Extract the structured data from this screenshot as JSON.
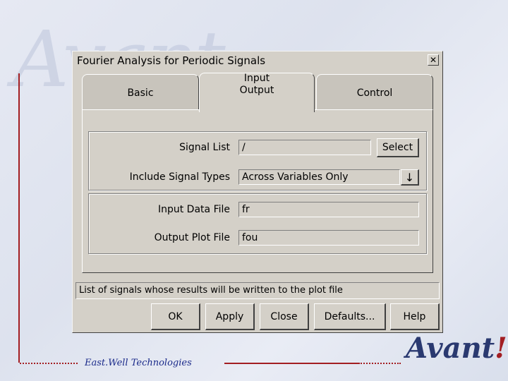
{
  "background": {
    "logo_text": "Avant",
    "footer_text": "East.Well Technologies",
    "corner_logo": "Avant",
    "corner_logo_mark": "!",
    "accent_color": "#a31e22",
    "logo_color": "#2a3970"
  },
  "window": {
    "title": "Fourier Analysis for Periodic Signals",
    "close_glyph": "✕"
  },
  "tabs": [
    {
      "label": "Basic",
      "active": false
    },
    {
      "label": "Input\nOutput",
      "active": true
    },
    {
      "label": "Control",
      "active": false
    }
  ],
  "form": {
    "signal_list": {
      "label": "Signal List",
      "value": "/",
      "button": "Select"
    },
    "signal_types": {
      "label": "Include Signal Types",
      "value": "Across Variables Only",
      "dropdown_glyph": "↓"
    },
    "input_file": {
      "label": "Input Data File",
      "value": "fr"
    },
    "output_file": {
      "label": "Output Plot File",
      "value": "fou"
    }
  },
  "status_text": "List of signals whose results will be written to the plot file",
  "buttons": {
    "ok": "OK",
    "apply": "Apply",
    "close": "Close",
    "defaults": "Defaults...",
    "help": "Help"
  }
}
